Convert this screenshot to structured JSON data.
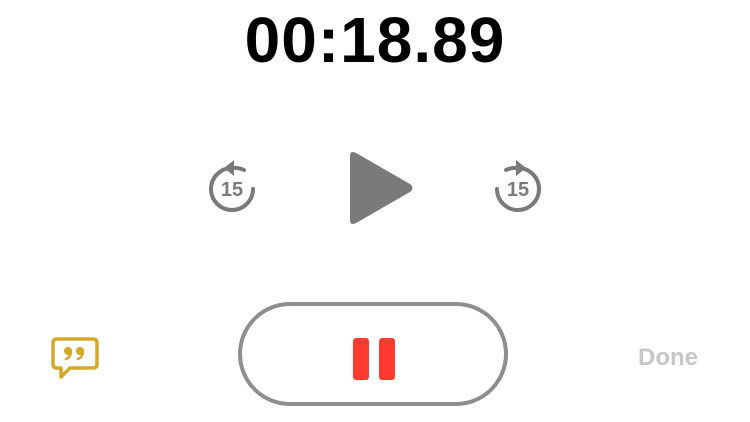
{
  "timer": {
    "elapsed": "00:18.89"
  },
  "controls": {
    "skip_back": {
      "label": "15",
      "icon": "skip-back-15-icon"
    },
    "play": {
      "icon": "play-icon"
    },
    "skip_forward": {
      "label": "15",
      "icon": "skip-forward-15-icon"
    }
  },
  "record_button": {
    "icon": "pause-icon"
  },
  "transcript_button": {
    "icon": "transcript-quote-bubble-icon"
  },
  "done_button": {
    "label": "Done"
  },
  "colors": {
    "accent_red": "#ff3b30",
    "transcript_yellow": "#d4a82a",
    "control_gray": "#7a7a7a",
    "done_gray": "#c7c7c7",
    "record_ring": "#8e8e8e"
  }
}
